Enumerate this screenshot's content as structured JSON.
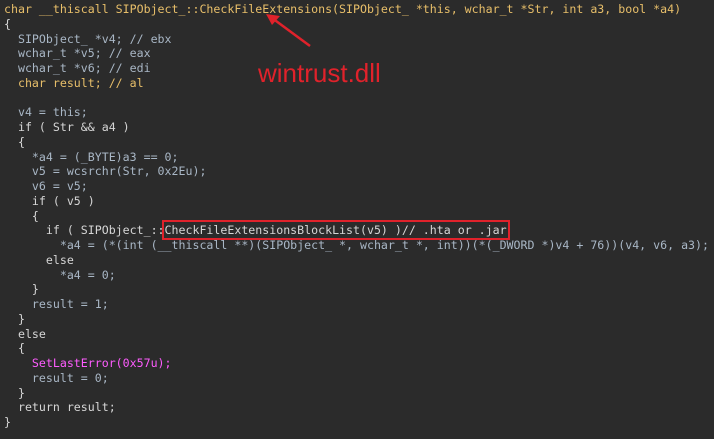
{
  "annotation": {
    "text": "wintrust.dll",
    "color": "#e0222b"
  },
  "colors": {
    "background": "#2b2b2b",
    "text": "#d6d6d6",
    "highlight_box": "#e0222b"
  },
  "lines": [
    "char __thiscall SIPObject_::CheckFileExtensions(SIPObject_ *this, wchar_t *Str, int a3, bool *a4)",
    "{",
    "  SIPObject_ *v4; // ebx",
    "  wchar_t *v5; // eax",
    "  wchar_t *v6; // edi",
    "  char result; // al",
    "",
    "  v4 = this;",
    "  if ( Str && a4 )",
    "  {",
    "    *a4 = (_BYTE)a3 == 0;",
    "    v5 = wcsrchr(Str, 0x2Eu);",
    "    v6 = v5;",
    "    if ( v5 )",
    "    {",
    "      if ( SIPObject_::",
    "        *a4 = (*(int (__thiscall **)(SIPObject_ *, wchar_t *, int))(*(_DWORD *)v4 + 76))(v4, v6, a3);",
    "      else",
    "        *a4 = 0;",
    "    }",
    "    result = 1;",
    "  }",
    "  else",
    "  {",
    "    SetLastError(0x57u);",
    "    result = 0;",
    "  }",
    "  return result;",
    "}"
  ],
  "boxed": "CheckFileExtensionsBlockList(v5) )// .hta or .jar"
}
